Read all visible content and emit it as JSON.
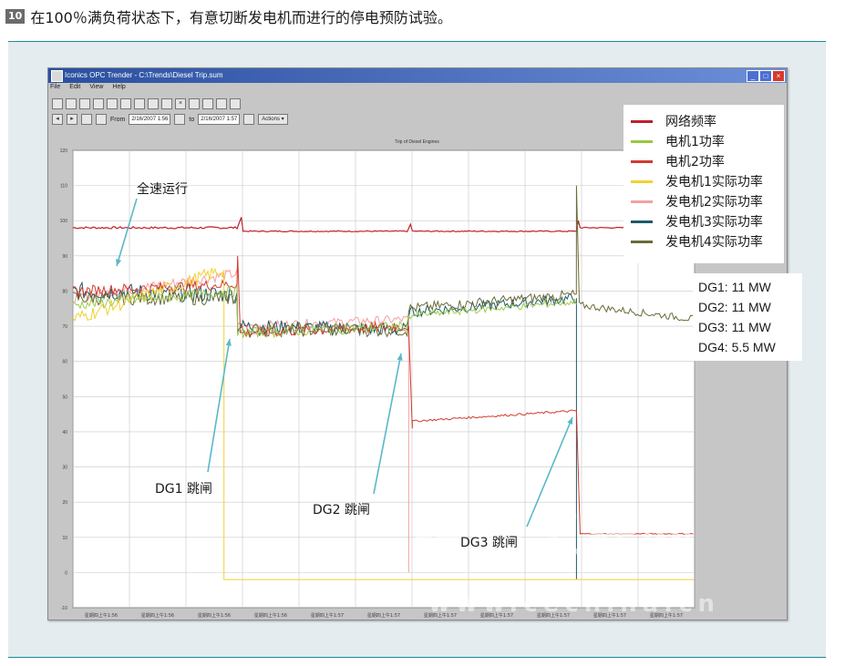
{
  "caption": {
    "number": "10",
    "text": "在100％满负荷状态下，有意切断发电机而进行的停电预防试验。"
  },
  "window": {
    "title": "Iconics OPC Trender - C:\\Trends\\Diesel Trip.sum",
    "menu": [
      "File",
      "Edit",
      "View",
      "Help"
    ],
    "from_label": "From",
    "from_value": "2/16/2007 1:56",
    "to_label": "to",
    "to_value": "2/16/2007 1:57",
    "actions_label": "Actions ▾",
    "chart_title": "Trip of Diesel Engines"
  },
  "chart_data": {
    "type": "line",
    "ylim": [
      -10,
      120
    ],
    "y_ticks": [
      "120",
      "110",
      "100",
      "90",
      "80",
      "70",
      "60",
      "50",
      "40",
      "30",
      "20",
      "10",
      "0",
      "-10"
    ],
    "x_ticks": [
      "星期四上午1:56",
      "星期四上午1:56",
      "星期四上午1:56",
      "星期四上午1:56",
      "星期四上午1:57",
      "星期四上午1:57",
      "星期四上午1:57",
      "星期四上午1:57",
      "星期四上午1:57",
      "星期四上午1:57",
      "星期四上午1:57"
    ],
    "legend_position": "top-right",
    "series": [
      {
        "name": "网络频率",
        "color": "#c0202a"
      },
      {
        "name": "电机1功率",
        "color": "#98c840"
      },
      {
        "name": "电机2功率",
        "color": "#d23a30"
      },
      {
        "name": "发电机1实际功率",
        "color": "#f4d030"
      },
      {
        "name": "发电机2实际功率",
        "color": "#f4a0a0"
      },
      {
        "name": "发电机3实际功率",
        "color": "#1f5a6a"
      },
      {
        "name": "发电机4实际功率",
        "color": "#6b6a38"
      }
    ]
  },
  "dg_ratings": [
    "DG1: 11 MW",
    "DG2: 11 MW",
    "DG3: 11 MW",
    "DG4: 5.5 MW"
  ],
  "annotations": {
    "full_speed": "全速运行",
    "dg1_trip": "DG1 跳闸",
    "dg2_trip": "DG2 跳闸",
    "dg3_trip": "DG3 跳闸"
  },
  "watermark": {
    "main": "控制工程网",
    "url": "www.cechina.cn"
  },
  "colors": {
    "panel_bg": "#e4ecef",
    "panel_rule": "#1b8a9a",
    "annotation_arrow": "#5ab8c8"
  }
}
